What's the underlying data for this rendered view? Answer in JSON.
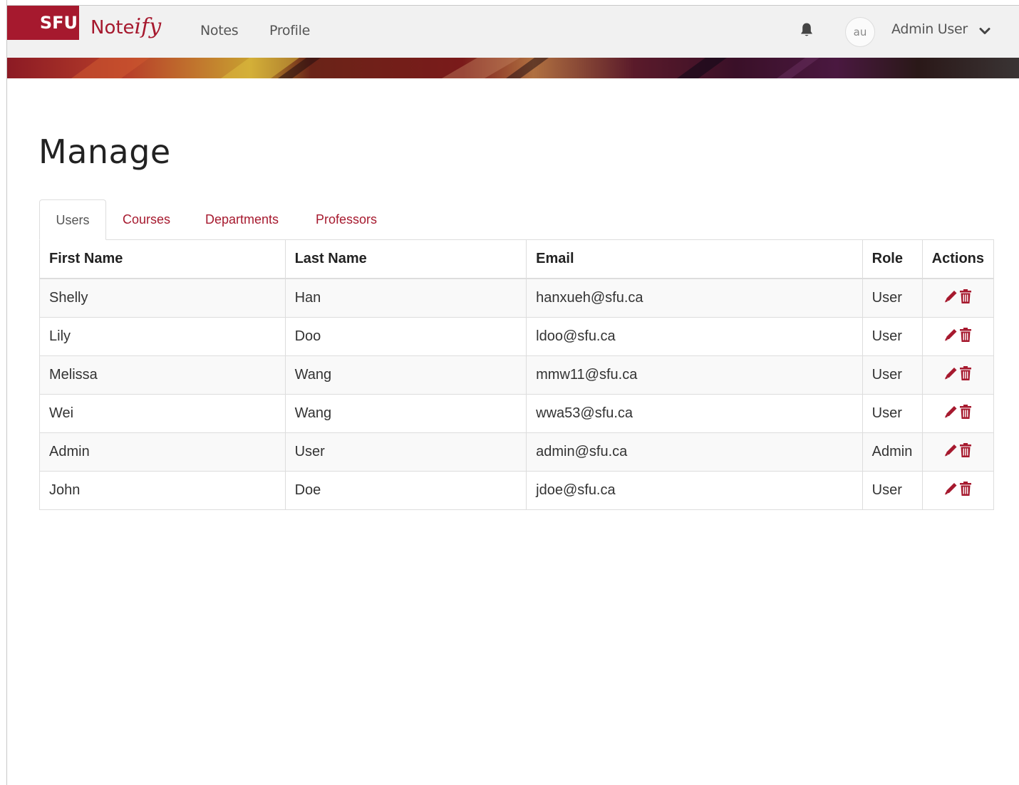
{
  "brand": {
    "sfu": "SFU",
    "note": "Note",
    "ify": "ify",
    "color": "#a6192e"
  },
  "nav": {
    "links": [
      "Notes",
      "Profile"
    ]
  },
  "user_menu": {
    "initials": "au",
    "name": "Admin User",
    "icons": [
      "bell-icon",
      "chevron-down-icon"
    ]
  },
  "page": {
    "title": "Manage"
  },
  "tabs": [
    {
      "label": "Users",
      "active": true
    },
    {
      "label": "Courses",
      "active": false
    },
    {
      "label": "Departments",
      "active": false
    },
    {
      "label": "Professors",
      "active": false
    }
  ],
  "table": {
    "headers": [
      "First Name",
      "Last Name",
      "Email",
      "Role",
      "Actions"
    ],
    "rows": [
      [
        "Shelly",
        "Han",
        "hanxueh@sfu.ca",
        "User"
      ],
      [
        "Lily",
        "Doo",
        "ldoo@sfu.ca",
        "User"
      ],
      [
        "Melissa",
        "Wang",
        "mmw11@sfu.ca",
        "User"
      ],
      [
        "Wei",
        "Wang",
        "wwa53@sfu.ca",
        "User"
      ],
      [
        "Admin",
        "User",
        "admin@sfu.ca",
        "Admin"
      ],
      [
        "John",
        "Doe",
        "jdoe@sfu.ca",
        "User"
      ]
    ],
    "row_actions": [
      "pencil-icon",
      "trash-icon"
    ]
  }
}
